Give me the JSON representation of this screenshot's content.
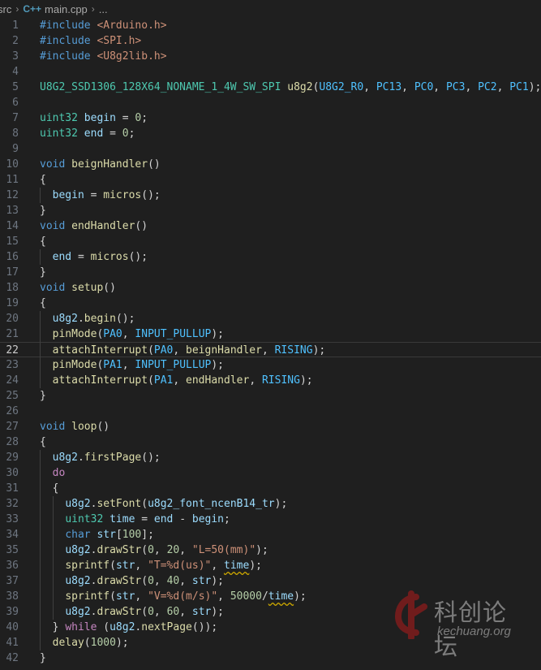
{
  "breadcrumb": {
    "folder": "src",
    "file_icon": "C++",
    "file": "main.cpp",
    "ellipsis": "..."
  },
  "editor": {
    "current_line": 22,
    "lines": [
      [
        [
          "pp",
          "#include"
        ],
        [
          "p",
          " "
        ],
        [
          "inc",
          "<Arduino.h>"
        ]
      ],
      [
        [
          "pp",
          "#include"
        ],
        [
          "p",
          " "
        ],
        [
          "inc",
          "<SPI.h>"
        ]
      ],
      [
        [
          "pp",
          "#include"
        ],
        [
          "p",
          " "
        ],
        [
          "inc",
          "<U8g2lib.h>"
        ]
      ],
      [],
      [
        [
          "type",
          "U8G2_SSD1306_128X64_NONAME_1_4W_SW_SPI"
        ],
        [
          "p",
          " "
        ],
        [
          "fn",
          "u8g2"
        ],
        [
          "p",
          "("
        ],
        [
          "const",
          "U8G2_R0"
        ],
        [
          "p",
          ", "
        ],
        [
          "const",
          "PC13"
        ],
        [
          "p",
          ", "
        ],
        [
          "const",
          "PC0"
        ],
        [
          "p",
          ", "
        ],
        [
          "const",
          "PC3"
        ],
        [
          "p",
          ", "
        ],
        [
          "const",
          "PC2"
        ],
        [
          "p",
          ", "
        ],
        [
          "const",
          "PC1"
        ],
        [
          "p",
          ");"
        ]
      ],
      [],
      [
        [
          "type",
          "uint32"
        ],
        [
          "p",
          " "
        ],
        [
          "var",
          "begin"
        ],
        [
          "p",
          " = "
        ],
        [
          "num",
          "0"
        ],
        [
          "p",
          ";"
        ]
      ],
      [
        [
          "type",
          "uint32"
        ],
        [
          "p",
          " "
        ],
        [
          "var",
          "end"
        ],
        [
          "p",
          " = "
        ],
        [
          "num",
          "0"
        ],
        [
          "p",
          ";"
        ]
      ],
      [],
      [
        [
          "kw",
          "void"
        ],
        [
          "p",
          " "
        ],
        [
          "fn",
          "beignHandler"
        ],
        [
          "p",
          "()"
        ]
      ],
      [
        [
          "p",
          "{"
        ]
      ],
      [
        [
          "p",
          "  "
        ],
        [
          "var",
          "begin"
        ],
        [
          "p",
          " = "
        ],
        [
          "fn",
          "micros"
        ],
        [
          "p",
          "();"
        ]
      ],
      [
        [
          "p",
          "}"
        ]
      ],
      [
        [
          "kw",
          "void"
        ],
        [
          "p",
          " "
        ],
        [
          "fn",
          "endHandler"
        ],
        [
          "p",
          "()"
        ]
      ],
      [
        [
          "p",
          "{"
        ]
      ],
      [
        [
          "p",
          "  "
        ],
        [
          "var",
          "end"
        ],
        [
          "p",
          " = "
        ],
        [
          "fn",
          "micros"
        ],
        [
          "p",
          "();"
        ]
      ],
      [
        [
          "p",
          "}"
        ]
      ],
      [
        [
          "kw",
          "void"
        ],
        [
          "p",
          " "
        ],
        [
          "fn",
          "setup"
        ],
        [
          "p",
          "()"
        ]
      ],
      [
        [
          "p",
          "{"
        ]
      ],
      [
        [
          "p",
          "  "
        ],
        [
          "var",
          "u8g2"
        ],
        [
          "p",
          "."
        ],
        [
          "fn",
          "begin"
        ],
        [
          "p",
          "();"
        ]
      ],
      [
        [
          "p",
          "  "
        ],
        [
          "fn",
          "pinMode"
        ],
        [
          "p",
          "("
        ],
        [
          "const",
          "PA0"
        ],
        [
          "p",
          ", "
        ],
        [
          "const",
          "INPUT_PULLUP"
        ],
        [
          "p",
          ");"
        ]
      ],
      [
        [
          "p",
          "  "
        ],
        [
          "fn",
          "attachInterrupt"
        ],
        [
          "p",
          "("
        ],
        [
          "const",
          "PA0"
        ],
        [
          "p",
          ", "
        ],
        [
          "fn",
          "beignHandler"
        ],
        [
          "p",
          ", "
        ],
        [
          "const",
          "RISING"
        ],
        [
          "p",
          ");"
        ]
      ],
      [
        [
          "p",
          "  "
        ],
        [
          "fn",
          "pinMode"
        ],
        [
          "p",
          "("
        ],
        [
          "const",
          "PA1"
        ],
        [
          "p",
          ", "
        ],
        [
          "const",
          "INPUT_PULLUP"
        ],
        [
          "p",
          ");"
        ]
      ],
      [
        [
          "p",
          "  "
        ],
        [
          "fn",
          "attachInterrupt"
        ],
        [
          "p",
          "("
        ],
        [
          "const",
          "PA1"
        ],
        [
          "p",
          ", "
        ],
        [
          "fn",
          "endHandler"
        ],
        [
          "p",
          ", "
        ],
        [
          "const",
          "RISING"
        ],
        [
          "p",
          ");"
        ]
      ],
      [
        [
          "p",
          "}"
        ]
      ],
      [],
      [
        [
          "kw",
          "void"
        ],
        [
          "p",
          " "
        ],
        [
          "fn",
          "loop"
        ],
        [
          "p",
          "()"
        ]
      ],
      [
        [
          "p",
          "{"
        ]
      ],
      [
        [
          "p",
          "  "
        ],
        [
          "var",
          "u8g2"
        ],
        [
          "p",
          "."
        ],
        [
          "fn",
          "firstPage"
        ],
        [
          "p",
          "();"
        ]
      ],
      [
        [
          "p",
          "  "
        ],
        [
          "ctl",
          "do"
        ]
      ],
      [
        [
          "p",
          "  {"
        ]
      ],
      [
        [
          "p",
          "    "
        ],
        [
          "var",
          "u8g2"
        ],
        [
          "p",
          "."
        ],
        [
          "fn",
          "setFont"
        ],
        [
          "p",
          "("
        ],
        [
          "var",
          "u8g2_font_ncenB14_tr"
        ],
        [
          "p",
          ");"
        ]
      ],
      [
        [
          "p",
          "    "
        ],
        [
          "type",
          "uint32"
        ],
        [
          "p",
          " "
        ],
        [
          "var",
          "time"
        ],
        [
          "p",
          " = "
        ],
        [
          "var",
          "end"
        ],
        [
          "p",
          " - "
        ],
        [
          "var",
          "begin"
        ],
        [
          "p",
          ";"
        ]
      ],
      [
        [
          "p",
          "    "
        ],
        [
          "kw",
          "char"
        ],
        [
          "p",
          " "
        ],
        [
          "var",
          "str"
        ],
        [
          "p",
          "["
        ],
        [
          "num",
          "100"
        ],
        [
          "p",
          "];"
        ]
      ],
      [
        [
          "p",
          "    "
        ],
        [
          "var",
          "u8g2"
        ],
        [
          "p",
          "."
        ],
        [
          "fn",
          "drawStr"
        ],
        [
          "p",
          "("
        ],
        [
          "num",
          "0"
        ],
        [
          "p",
          ", "
        ],
        [
          "num",
          "20"
        ],
        [
          "p",
          ", "
        ],
        [
          "str",
          "\"L=50(mm)\""
        ],
        [
          "p",
          ");"
        ]
      ],
      [
        [
          "p",
          "    "
        ],
        [
          "fn",
          "sprintf"
        ],
        [
          "p",
          "("
        ],
        [
          "var",
          "str"
        ],
        [
          "p",
          ", "
        ],
        [
          "str",
          "\"T=%d(us)\""
        ],
        [
          "p",
          ", "
        ],
        [
          "var",
          "time",
          "sq"
        ],
        [
          "p",
          ");"
        ]
      ],
      [
        [
          "p",
          "    "
        ],
        [
          "var",
          "u8g2"
        ],
        [
          "p",
          "."
        ],
        [
          "fn",
          "drawStr"
        ],
        [
          "p",
          "("
        ],
        [
          "num",
          "0"
        ],
        [
          "p",
          ", "
        ],
        [
          "num",
          "40"
        ],
        [
          "p",
          ", "
        ],
        [
          "var",
          "str"
        ],
        [
          "p",
          ");"
        ]
      ],
      [
        [
          "p",
          "    "
        ],
        [
          "fn",
          "sprintf"
        ],
        [
          "p",
          "("
        ],
        [
          "var",
          "str"
        ],
        [
          "p",
          ", "
        ],
        [
          "str",
          "\"V=%d(m/s)\""
        ],
        [
          "p",
          ", "
        ],
        [
          "num",
          "50000"
        ],
        [
          "p",
          "/"
        ],
        [
          "var",
          "time",
          "sq"
        ],
        [
          "p",
          ");"
        ]
      ],
      [
        [
          "p",
          "    "
        ],
        [
          "var",
          "u8g2"
        ],
        [
          "p",
          "."
        ],
        [
          "fn",
          "drawStr"
        ],
        [
          "p",
          "("
        ],
        [
          "num",
          "0"
        ],
        [
          "p",
          ", "
        ],
        [
          "num",
          "60"
        ],
        [
          "p",
          ", "
        ],
        [
          "var",
          "str"
        ],
        [
          "p",
          ");"
        ]
      ],
      [
        [
          "p",
          "  } "
        ],
        [
          "ctl",
          "while"
        ],
        [
          "p",
          " ("
        ],
        [
          "var",
          "u8g2"
        ],
        [
          "p",
          "."
        ],
        [
          "fn",
          "nextPage"
        ],
        [
          "p",
          "());"
        ]
      ],
      [
        [
          "p",
          "  "
        ],
        [
          "fn",
          "delay"
        ],
        [
          "p",
          "("
        ],
        [
          "num",
          "1000"
        ],
        [
          "p",
          ");"
        ]
      ],
      [
        [
          "p",
          "}"
        ]
      ]
    ]
  },
  "watermark": {
    "title": "科创论坛",
    "url": "kechuang.org"
  },
  "colors": {
    "background": "#1f1f1f",
    "keyword": "#569cd6",
    "control": "#c586c0",
    "string": "#ce9178",
    "number": "#b5cea8",
    "function": "#dcdcaa",
    "variable": "#9cdcfe",
    "constant": "#4fc1ff",
    "type": "#4ec9b0",
    "watermark_logo": "#8b1c1c"
  }
}
